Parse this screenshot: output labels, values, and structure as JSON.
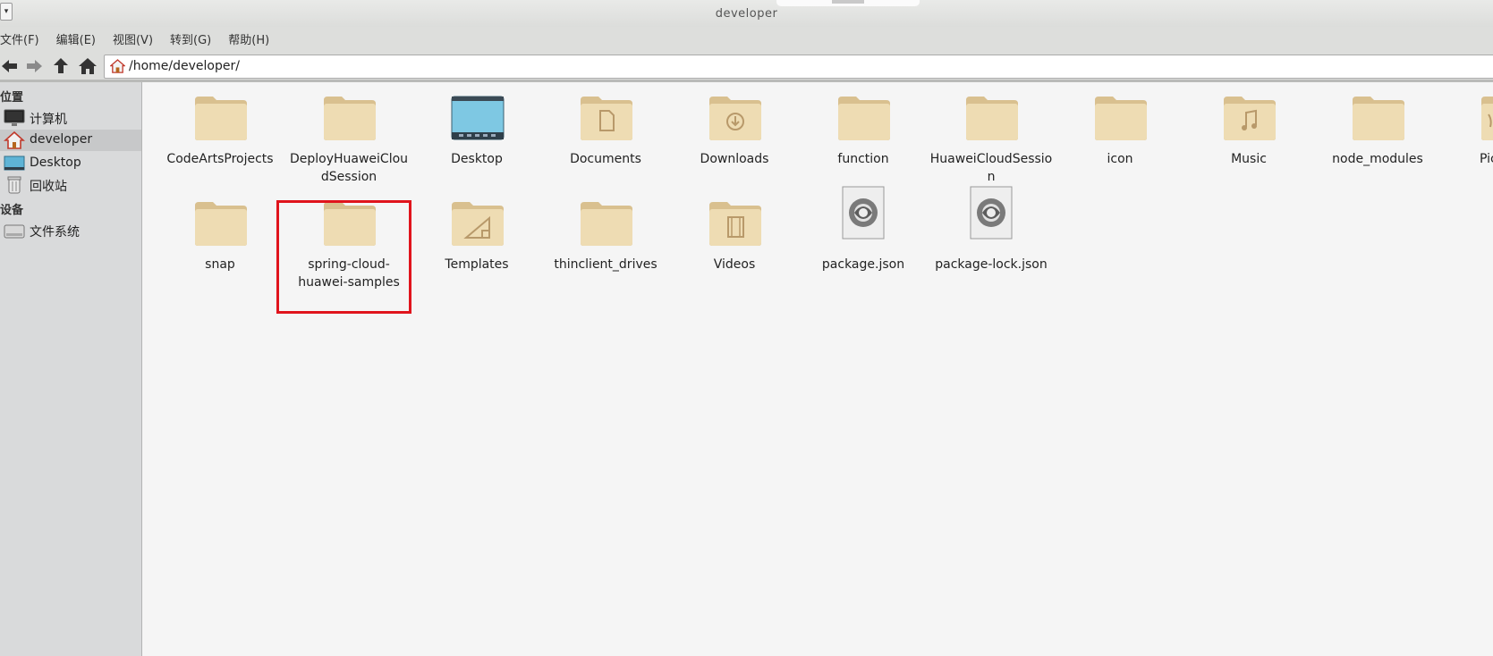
{
  "window": {
    "title": "developer"
  },
  "menubar": [
    {
      "label": "文件(F)"
    },
    {
      "label": "编辑(E)"
    },
    {
      "label": "视图(V)"
    },
    {
      "label": "转到(G)"
    },
    {
      "label": "帮助(H)"
    }
  ],
  "toolbar": {
    "address": "/home/developer/"
  },
  "sidebar": {
    "places_header": "位置",
    "places": [
      {
        "label": "计算机",
        "icon": "monitor-icon"
      },
      {
        "label": "developer",
        "icon": "home-icon",
        "active": true
      },
      {
        "label": "Desktop",
        "icon": "desktop-icon"
      },
      {
        "label": "回收站",
        "icon": "trash-icon"
      }
    ],
    "devices_header": "设备",
    "devices": [
      {
        "label": "文件系统",
        "icon": "drive-icon"
      }
    ]
  },
  "files": [
    {
      "name": "CodeArtsProjects",
      "icon": "folder-icon"
    },
    {
      "name": "DeployHuaweiCloudSession",
      "icon": "folder-icon"
    },
    {
      "name": "Desktop",
      "icon": "desktop-folder-icon"
    },
    {
      "name": "Documents",
      "icon": "documents-folder-icon"
    },
    {
      "name": "Downloads",
      "icon": "downloads-folder-icon"
    },
    {
      "name": "function",
      "icon": "folder-icon"
    },
    {
      "name": "HuaweiCloudSession",
      "icon": "folder-icon"
    },
    {
      "name": "icon",
      "icon": "folder-icon"
    },
    {
      "name": "Music",
      "icon": "music-folder-icon"
    },
    {
      "name": "node_modules",
      "icon": "folder-icon"
    },
    {
      "name": "Pic",
      "icon": "pictures-folder-icon"
    },
    {
      "name": "snap",
      "icon": "folder-icon"
    },
    {
      "name": "spring-cloud-huawei-samples",
      "icon": "folder-icon",
      "highlighted": true
    },
    {
      "name": "Templates",
      "icon": "templates-folder-icon"
    },
    {
      "name": "thinclient_drives",
      "icon": "folder-icon"
    },
    {
      "name": "Videos",
      "icon": "videos-folder-icon"
    },
    {
      "name": "package.json",
      "icon": "json-file-icon"
    },
    {
      "name": "package-lock.json",
      "icon": "json-file-icon"
    }
  ],
  "colors": {
    "folder": "#eedcb3",
    "folder_dark": "#d9c08f",
    "highlight": "#e0141c",
    "desktop_blue": "#7ec8e3"
  }
}
